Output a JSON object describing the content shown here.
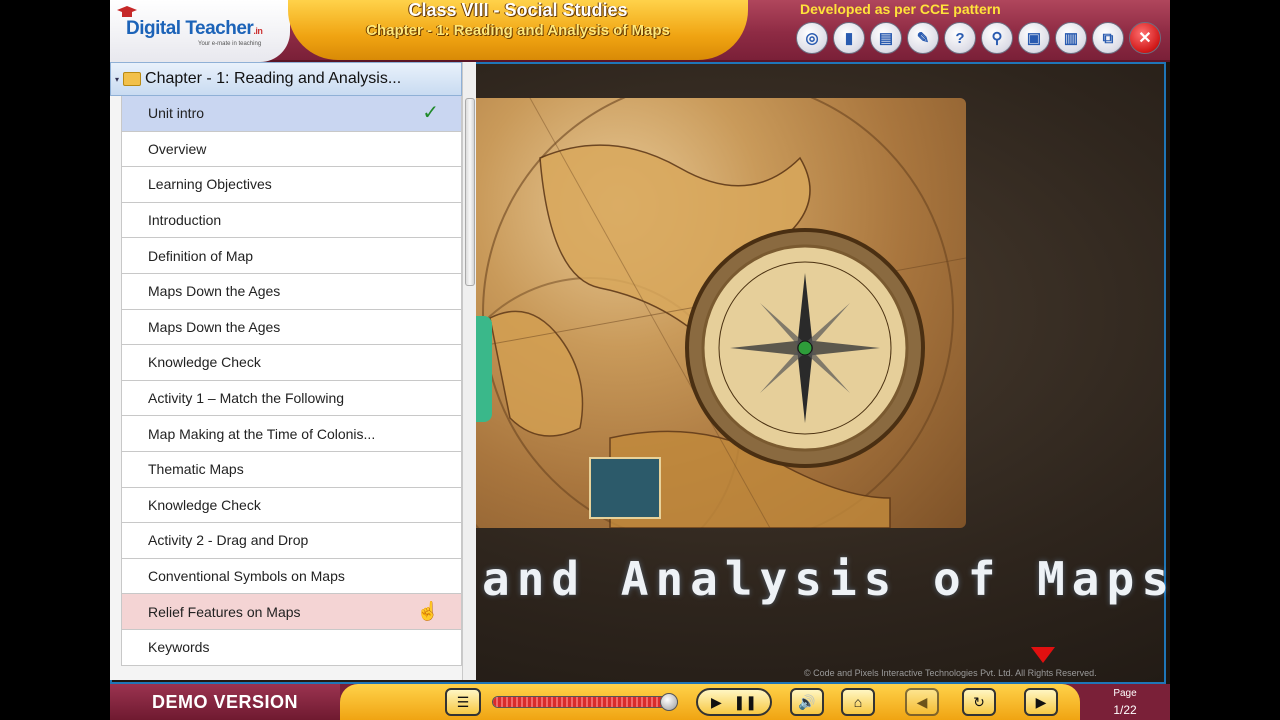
{
  "header": {
    "logo_text": "Digital Teacher",
    "logo_suffix": ".in",
    "logo_tagline": "Your e-mate in teaching",
    "title_line1": "Class VIII - Social Studies",
    "title_line2": "Chapter - 1: Reading and Analysis of Maps",
    "cce_text": "Developed as per CCE pattern",
    "toolbar": [
      {
        "name": "globe-tool",
        "glyph": "◎"
      },
      {
        "name": "book-tool",
        "glyph": "▮"
      },
      {
        "name": "library-tool",
        "glyph": "▤"
      },
      {
        "name": "notes-tool",
        "glyph": "✎"
      },
      {
        "name": "help-tool",
        "glyph": "?"
      },
      {
        "name": "search-tool",
        "glyph": "⚲"
      },
      {
        "name": "dictionary-tool",
        "glyph": "▣"
      },
      {
        "name": "notebook-tool",
        "glyph": "▥"
      },
      {
        "name": "window-tool",
        "glyph": "⧉"
      },
      {
        "name": "close-tool",
        "glyph": "✕"
      }
    ]
  },
  "sidebar": {
    "chapter_title": "Chapter - 1: Reading and Analysis...",
    "items": [
      {
        "label": "Unit intro",
        "state": "active",
        "checked": true
      },
      {
        "label": "Overview"
      },
      {
        "label": "Learning Objectives"
      },
      {
        "label": "Introduction"
      },
      {
        "label": "Definition of Map"
      },
      {
        "label": "Maps Down the Ages"
      },
      {
        "label": "Maps Down the Ages"
      },
      {
        "label": "Knowledge Check"
      },
      {
        "label": "Activity 1 – Match the Following"
      },
      {
        "label": "Map Making at the Time of Colonis..."
      },
      {
        "label": "Thematic Maps"
      },
      {
        "label": "Knowledge Check"
      },
      {
        "label": "Activity 2 - Drag and Drop"
      },
      {
        "label": "Conventional Symbols on Maps"
      },
      {
        "label": "Relief Features on Maps",
        "state": "hover"
      },
      {
        "label": "Keywords"
      }
    ],
    "check_glyph": "✓",
    "cursor_glyph": "☝"
  },
  "content": {
    "heading": "and Analysis of Maps",
    "copyright": "© Code and Pixels Interactive Technologies  Pvt. Ltd. All Rights Reserved."
  },
  "footer": {
    "demo_label": "DEMO VERSION",
    "progress": 0.92,
    "page_label": "Page",
    "page_value": "1/22",
    "buttons": {
      "menu": "☰",
      "play": "▶",
      "pause": "❚❚",
      "audio": "🔊",
      "home": "⌂",
      "prev": "◀",
      "replay": "↻",
      "next": "▶"
    }
  }
}
